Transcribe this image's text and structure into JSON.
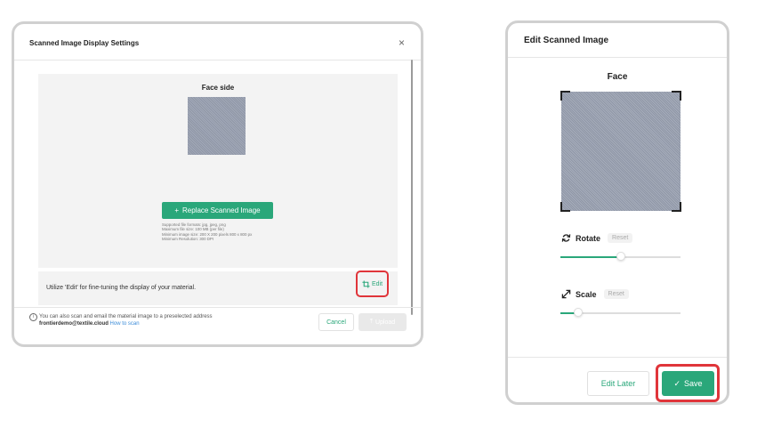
{
  "left_dialog": {
    "title": "Scanned Image Display Settings",
    "close_icon": "×",
    "preview": {
      "label": "Face side",
      "replace_button_icon": "+",
      "replace_button_label": "Replace Scanned Image",
      "specs": [
        "Supported file formats: jpg, jpeg, png",
        "Maximum file size: 100 MB (per file)",
        "Minimum image size: 200 X 200 pixels 800 x 800 px",
        "Minimum Resolution: 300 DPI"
      ]
    },
    "edit_strip": {
      "text": "Utilize 'Edit' for fine-tuning the display of your material.",
      "edit_label": "Edit"
    },
    "footer": {
      "info_icon": "i",
      "info_text": "You can also scan and email the material image to a preselected address",
      "email": "frontierdemo@textile.cloud",
      "how_to_scan": "How to scan",
      "cancel_label": "Cancel",
      "upload_label": "Upload"
    }
  },
  "right_dialog": {
    "title": "Edit Scanned Image",
    "face_label": "Face",
    "rotate": {
      "label": "Rotate",
      "reset_label": "Reset",
      "value_fraction": 0.5
    },
    "scale": {
      "label": "Scale",
      "reset_label": "Reset",
      "value_fraction": 0.15
    },
    "edit_later_label": "Edit Later",
    "save_label": "Save"
  },
  "colors": {
    "accent_green": "#2aa77a",
    "highlight_red": "#e0353a",
    "link_blue": "#3a8bd8"
  }
}
